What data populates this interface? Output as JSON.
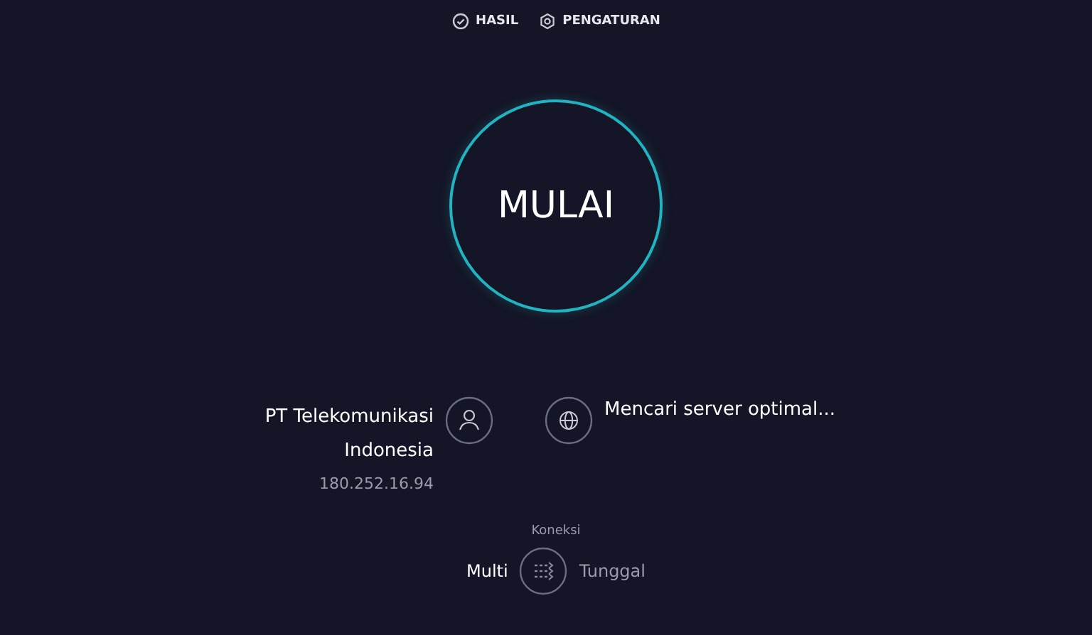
{
  "nav": [
    {
      "label": "HASIL",
      "kind": "check"
    },
    {
      "label": "PENGATURAN",
      "kind": "gear"
    }
  ],
  "start_button": {
    "label": "MULAI"
  },
  "provider": {
    "name_lines": [
      "PT Telekomunikasi",
      "Indonesia"
    ],
    "ip": "180.252.16.94"
  },
  "server": {
    "status": "Mencari server optimal..."
  },
  "connection": {
    "label": "Koneksi",
    "options": [
      {
        "label": "Multi",
        "selected": true
      },
      {
        "label": "Tunggal",
        "selected": false
      }
    ]
  }
}
